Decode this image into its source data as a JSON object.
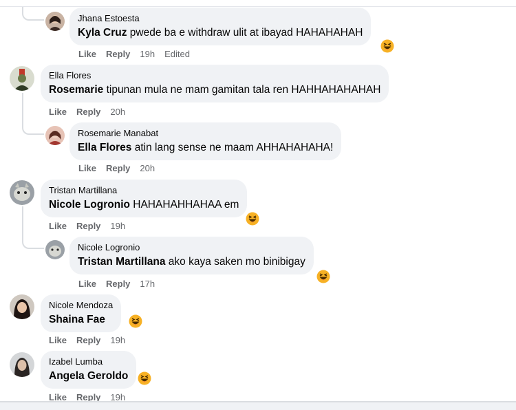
{
  "comments": [
    {
      "name": "Jhana Estoesta",
      "tag": "Kyla Cruz",
      "text": " pwede ba e withdraw ulit at ibayad HAHAHAHAH",
      "like": "Like",
      "reply": "Reply",
      "time": "19h",
      "edited": "Edited",
      "reaction": "haha-icon"
    },
    {
      "name": "Ella Flores",
      "tag": "Rosemarie",
      "text": " tipunan mula ne mam gamitan tala ren HAHHAHAHAHAH",
      "like": "Like",
      "reply": "Reply",
      "time": "20h"
    },
    {
      "name": "Rosemarie Manabat",
      "tag": "Ella Flores",
      "text": " atin lang sense ne maam AHHAHAHAHA!",
      "like": "Like",
      "reply": "Reply",
      "time": "20h"
    },
    {
      "name": "Tristan Martillana",
      "tag": "Nicole Logronio",
      "text": " HAHAHAHHAHAA em",
      "like": "Like",
      "reply": "Reply",
      "time": "19h",
      "reaction": "haha-icon"
    },
    {
      "name": "Nicole Logronio",
      "tag": "Tristan Martillana",
      "text": " ako kaya saken mo binibigay",
      "like": "Like",
      "reply": "Reply",
      "time": "17h",
      "reaction": "haha-icon"
    },
    {
      "name": "Nicole Mendoza",
      "tag": "Shaina Fae",
      "text": "",
      "like": "Like",
      "reply": "Reply",
      "time": "19h",
      "reaction": "haha-icon"
    },
    {
      "name": "Izabel Lumba",
      "tag": "Angela Geroldo",
      "text": "",
      "like": "Like",
      "reply": "Reply",
      "time": "19h",
      "reaction": "haha-icon"
    }
  ],
  "colors": {
    "bubble": "#f0f2f5",
    "meta": "#65676b",
    "reaction": "#f7b125"
  }
}
